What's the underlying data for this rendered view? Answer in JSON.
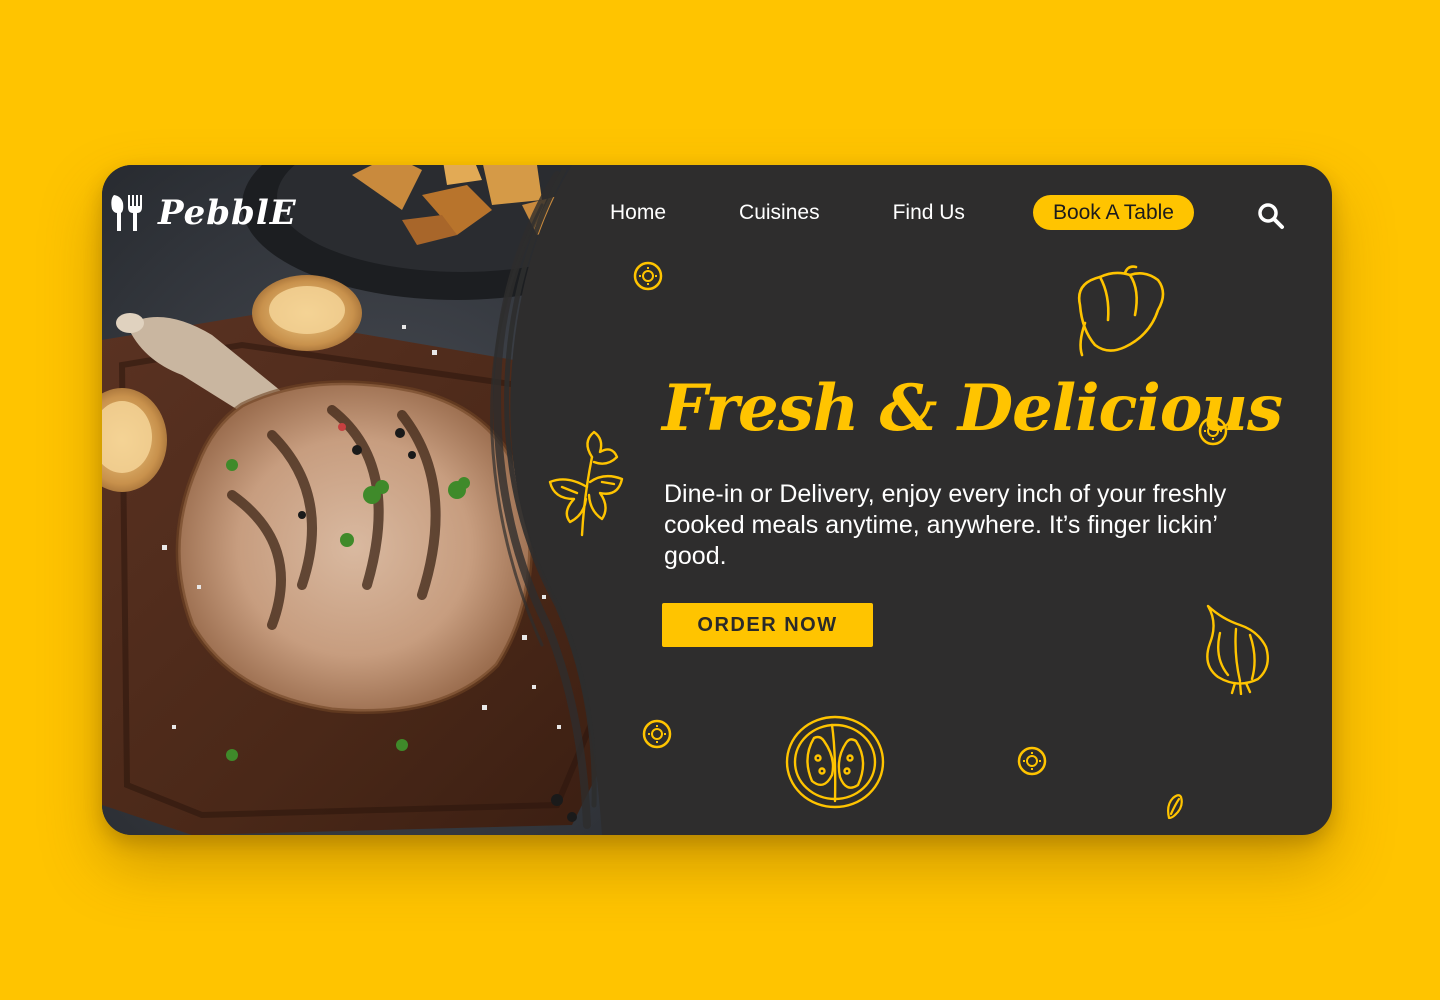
{
  "brand": {
    "name": "PebblE",
    "logo_icon": "fork-knife-icon"
  },
  "nav": {
    "items": [
      {
        "label": "Home"
      },
      {
        "label": "Cuisines"
      },
      {
        "label": "Find Us"
      }
    ],
    "book_label": "Book A Table",
    "search_icon": "search-icon"
  },
  "hero": {
    "title": "Fresh & Delicious",
    "description": "Dine-in or Delivery, enjoy every inch of your freshly cooked meals anytime, anywhere. It’s finger lickin’ good.",
    "cta_label": "ORDER NOW",
    "image": "grilled-pork-chop-photo"
  },
  "colors": {
    "page_background": "#ffc400",
    "card_background": "#2e2d2d",
    "accent": "#ffc400",
    "text": "#ffffff"
  },
  "doodles": [
    "sun-icon",
    "bell-pepper-icon",
    "parsley-icon",
    "garlic-icon",
    "tomato-slice-icon",
    "seed-icon"
  ]
}
